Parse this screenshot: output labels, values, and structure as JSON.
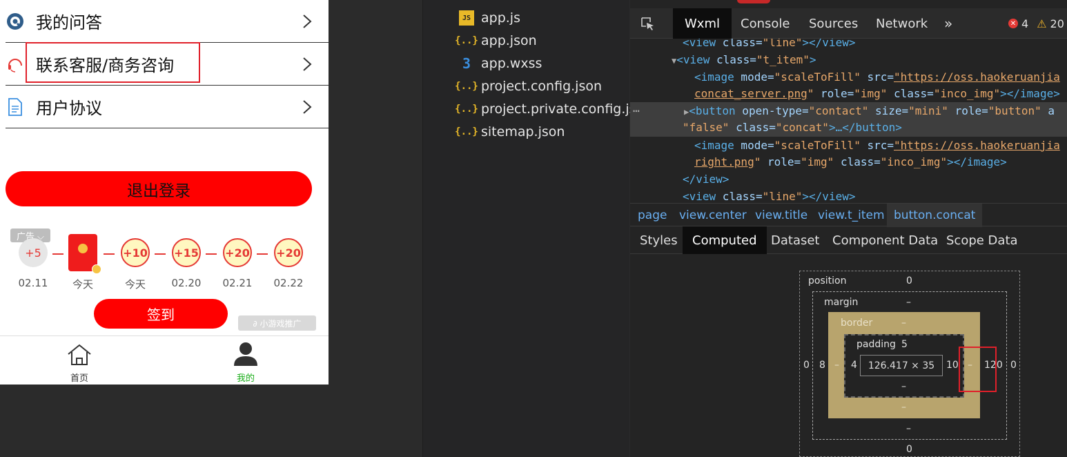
{
  "phone": {
    "menu": [
      {
        "label": "我的问答",
        "icon": "question-circle-icon"
      },
      {
        "label": "联系客服/商务咨询",
        "icon": "headset-icon"
      },
      {
        "label": "用户协议",
        "icon": "document-icon"
      }
    ],
    "logout_label": "退出登录",
    "ad_tag": "广告 ⌵",
    "checkin_days": [
      {
        "reward": "+5",
        "date": "02.11",
        "state": "past"
      },
      {
        "reward": "",
        "date": "今天",
        "state": "packet"
      },
      {
        "reward": "+10",
        "date": "今天",
        "state": "future"
      },
      {
        "reward": "+15",
        "date": "02.20",
        "state": "future"
      },
      {
        "reward": "+20",
        "date": "02.21",
        "state": "future"
      },
      {
        "reward": "+20",
        "date": "02.22",
        "state": "future"
      }
    ],
    "signin_label": "签到",
    "promo_label": "∂ 小游戏推广",
    "tabbar": {
      "home_label": "首页",
      "mine_label": "我的",
      "active_color": "#1aad19"
    }
  },
  "files": [
    {
      "name": "app.js",
      "type": "js",
      "icon_text": "JS"
    },
    {
      "name": "app.json",
      "type": "json",
      "icon_text": "{..}"
    },
    {
      "name": "app.wxss",
      "type": "css",
      "icon_text": "3"
    },
    {
      "name": "project.config.json",
      "type": "json",
      "icon_text": "{..}"
    },
    {
      "name": "project.private.config.js...",
      "type": "json",
      "icon_text": "{..}"
    },
    {
      "name": "sitemap.json",
      "type": "json",
      "icon_text": "{..}"
    }
  ],
  "devtools": {
    "tabs": [
      "Wxml",
      "Console",
      "Sources",
      "Network",
      "»"
    ],
    "active_tab": "Wxml",
    "errors": "4",
    "warnings": "20",
    "code": {
      "l1": [
        "<view",
        " class=",
        "\"line\"",
        "></view>"
      ],
      "l2": [
        "<view",
        " class=",
        "\"t_item\"",
        ">"
      ],
      "l3a": [
        "<image",
        " mode=",
        "\"scaleToFill\"",
        " src=",
        "\"https://oss.haokeruanjia"
      ],
      "l3b": [
        "concat_server.png",
        "\"",
        " role=",
        "\"img\"",
        " class=",
        "\"inco_img\"",
        "></image>"
      ],
      "l4a": [
        "<button",
        " open-type=",
        "\"contact\"",
        " size=",
        "\"mini\"",
        " role=",
        "\"button\"",
        " a"
      ],
      "l4b": [
        "\"false\"",
        " class=",
        "\"concat\"",
        ">…</button>"
      ],
      "l5a": [
        "<image",
        " mode=",
        "\"scaleToFill\"",
        " src=",
        "\"https://oss.haokeruanjia"
      ],
      "l5b": [
        "right.png",
        "\"",
        " role=",
        "\"img\"",
        " class=",
        "\"inco_img\"",
        "></image>"
      ],
      "l6": [
        "</view>"
      ],
      "l7": [
        "<view",
        " class=",
        "\"line\"",
        "></view>"
      ],
      "ellipsis": "⋯"
    },
    "breadcrumbs": [
      "page",
      "view.center",
      "view.title",
      "view.t_item",
      "button.concat"
    ],
    "panel_tabs": [
      "Styles",
      "Computed",
      "Dataset",
      "Component Data",
      "Scope Data"
    ],
    "active_panel": "Computed",
    "box_model": {
      "position_label": "position",
      "position_top": "0",
      "position_bottom": "0",
      "position_left": "0",
      "position_right": "0",
      "margin_label": "margin",
      "margin_top": "–",
      "margin_bottom": "–",
      "margin_left": "8",
      "margin_right": "120",
      "border_label": "border",
      "border_top": "–",
      "border_bottom": "–",
      "border_left": "–",
      "border_right": "–",
      "padding_label": "padding",
      "padding_top": "5",
      "padding_bottom": "–",
      "padding_left": "4",
      "padding_right": "10",
      "content": "126.417 × 35"
    }
  }
}
